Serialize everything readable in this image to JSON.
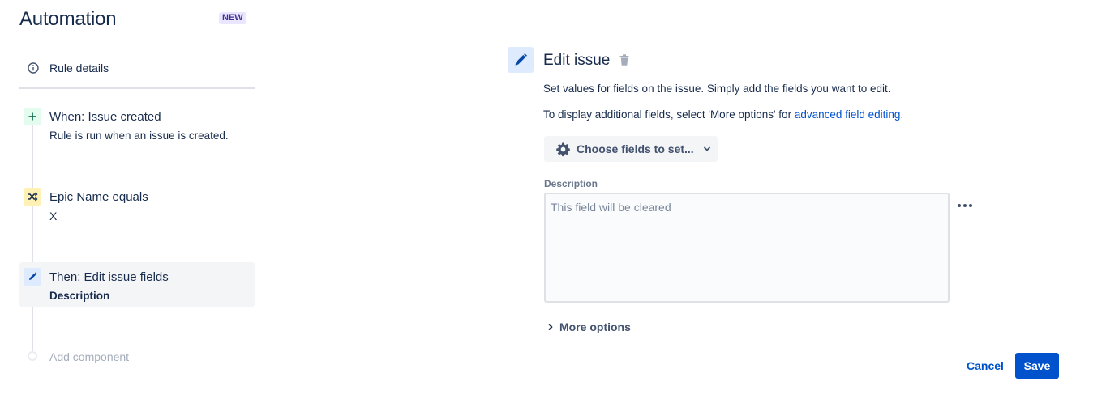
{
  "app": {
    "title": "Automation",
    "badge": "NEW"
  },
  "sidebar": {
    "rule_details": {
      "label": "Rule details",
      "icon": "info-icon"
    },
    "steps": [
      {
        "type": "trigger",
        "icon": "plus-icon",
        "title": "When: Issue created",
        "subtitle": "Rule is run when an issue is created.",
        "color": "#e3fcef"
      },
      {
        "type": "condition",
        "icon": "shuffle-icon",
        "title": "Epic Name equals",
        "subtitle": "X",
        "color": "#fff0b3"
      },
      {
        "type": "action",
        "icon": "pencil-icon",
        "title": "Then: Edit issue fields",
        "subtitle": "Description",
        "color": "#deebff",
        "selected": true
      }
    ],
    "add_component": {
      "label": "Add component"
    }
  },
  "panel": {
    "title": "Edit issue",
    "description": "Set values for fields on the issue. Simply add the fields you want to edit.",
    "additional_prefix": "To display additional fields, select 'More options' for ",
    "additional_link": "advanced field editing",
    "additional_suffix": ".",
    "choose_fields": {
      "label": "Choose fields to set...",
      "icon": "gear-icon"
    },
    "field": {
      "label": "Description",
      "value": "",
      "placeholder": "This field will be cleared"
    },
    "more_options": {
      "label": "More options"
    },
    "cancel_label": "Cancel",
    "save_label": "Save"
  },
  "colors": {
    "primary": "#0052cc",
    "text": "#172b4d",
    "badge_bg": "#eae6ff",
    "badge_text": "#403294"
  }
}
